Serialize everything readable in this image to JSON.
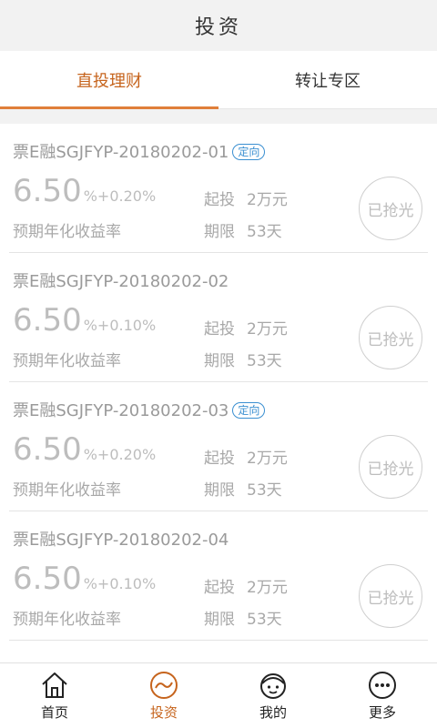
{
  "header": {
    "title": "投资"
  },
  "tabs": [
    {
      "label": "直投理财",
      "active": true
    },
    {
      "label": "转让专区",
      "active": false
    }
  ],
  "products": [
    {
      "title": "票E融SGJFYP-20180202-01",
      "badge": "定向",
      "rate_main": "6.50",
      "rate_extra": "%+0.20%",
      "rate_label": "预期年化收益率",
      "min_label": "起投",
      "min_value": "2万元",
      "term_label": "期限",
      "term_value": "53天",
      "status": "已抢光"
    },
    {
      "title": "票E融SGJFYP-20180202-02",
      "badge": "",
      "rate_main": "6.50",
      "rate_extra": "%+0.10%",
      "rate_label": "预期年化收益率",
      "min_label": "起投",
      "min_value": "2万元",
      "term_label": "期限",
      "term_value": "53天",
      "status": "已抢光"
    },
    {
      "title": "票E融SGJFYP-20180202-03",
      "badge": "定向",
      "rate_main": "6.50",
      "rate_extra": "%+0.20%",
      "rate_label": "预期年化收益率",
      "min_label": "起投",
      "min_value": "2万元",
      "term_label": "期限",
      "term_value": "53天",
      "status": "已抢光"
    },
    {
      "title": "票E融SGJFYP-20180202-04",
      "badge": "",
      "rate_main": "6.50",
      "rate_extra": "%+0.10%",
      "rate_label": "预期年化收益率",
      "min_label": "起投",
      "min_value": "2万元",
      "term_label": "期限",
      "term_value": "53天",
      "status": "已抢光"
    }
  ],
  "bottom_nav": [
    {
      "label": "首页",
      "icon": "home-icon",
      "active": false
    },
    {
      "label": "投资",
      "icon": "invest-icon",
      "active": true
    },
    {
      "label": "我的",
      "icon": "profile-icon",
      "active": false
    },
    {
      "label": "更多",
      "icon": "more-icon",
      "active": false
    }
  ],
  "colors": {
    "accent": "#c6641d",
    "badge": "#3a8fd1",
    "muted": "#a8a8a8"
  }
}
